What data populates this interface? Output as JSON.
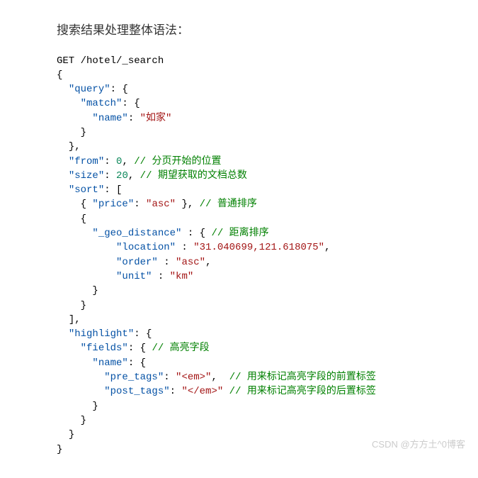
{
  "title": "搜索结果处理整体语法：",
  "request_line": "GET /hotel/_search",
  "keys": {
    "query": "\"query\"",
    "match": "\"match\"",
    "name": "\"name\"",
    "from": "\"from\"",
    "size": "\"size\"",
    "sort": "\"sort\"",
    "price": "\"price\"",
    "geo": "\"_geo_distance\"",
    "location": "\"location\"",
    "order": "\"order\"",
    "unit": "\"unit\"",
    "highlight": "\"highlight\"",
    "fields": "\"fields\"",
    "pre_tags": "\"pre_tags\"",
    "post_tags": "\"post_tags\""
  },
  "vals": {
    "name": "\"如家\"",
    "from": "0",
    "size": "20",
    "asc1": "\"asc\"",
    "location": "\"31.040699,121.618075\"",
    "order": "\"asc\"",
    "unit": "\"km\"",
    "pre_tags": "\"<em>\"",
    "post_tags": "\"</em>\""
  },
  "comments": {
    "from": "// 分页开始的位置",
    "size": "// 期望获取的文档总数",
    "normal_sort": "// 普通排序",
    "distance_sort": "// 距离排序",
    "highlight_fields": "// 高亮字段",
    "pre_tags": "// 用来标记高亮字段的前置标签",
    "post_tags": "// 用来标记高亮字段的后置标签"
  },
  "watermark": "CSDN @方方土^0博客"
}
